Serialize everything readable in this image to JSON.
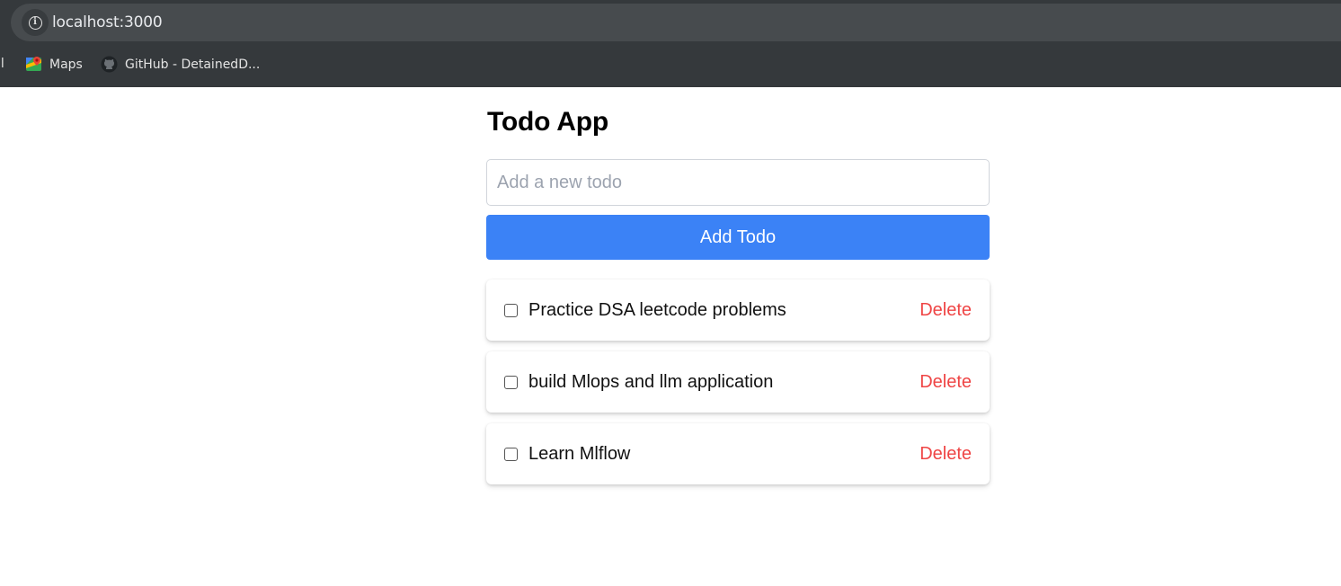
{
  "browser": {
    "url": "localhost:3000",
    "bookmarks": [
      {
        "label": "il"
      },
      {
        "label": "Maps",
        "icon": "maps-icon"
      },
      {
        "label": "GitHub - DetainedD...",
        "icon": "github-icon"
      }
    ]
  },
  "app": {
    "title": "Todo App",
    "input": {
      "placeholder": "Add a new todo",
      "value": ""
    },
    "add_button_label": "Add Todo",
    "todos": [
      {
        "text": "Practice DSA leetcode problems",
        "completed": false,
        "delete_label": "Delete"
      },
      {
        "text": "build Mlops and llm application",
        "completed": false,
        "delete_label": "Delete"
      },
      {
        "text": "Learn Mlflow",
        "completed": false,
        "delete_label": "Delete"
      }
    ]
  },
  "colors": {
    "primary_button": "#3b82f6",
    "delete_text": "#ef4444",
    "chrome_bg": "#35393c"
  }
}
